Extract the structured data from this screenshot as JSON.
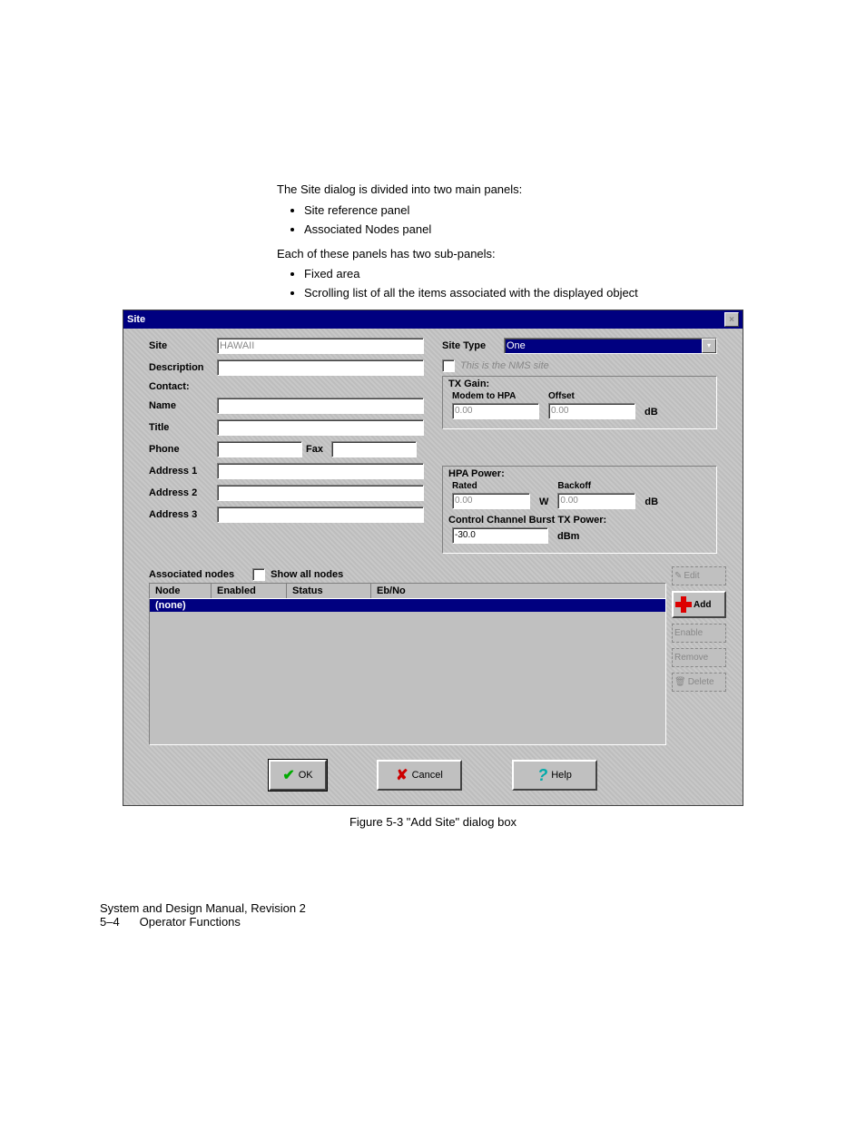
{
  "intro": {
    "line1": "The Site dialog is divided into two main panels:",
    "bullet1a": "Site reference panel",
    "bullet1b": "Associated Nodes panel",
    "line2": "Each of these panels has two sub-panels:",
    "bullet2a": "Fixed area",
    "bullet2b": "Scrolling list of all the items associated with the displayed object"
  },
  "dialog": {
    "title": "Site",
    "left": {
      "site_label": "Site",
      "site_value": "HAWAII",
      "desc_label": "Description",
      "contact_label": "Contact:",
      "name_label": "Name",
      "title_label": "Title",
      "phone_label": "Phone",
      "fax_label": "Fax",
      "addr1_label": "Address 1",
      "addr2_label": "Address 2",
      "addr3_label": "Address 3"
    },
    "right": {
      "sitetype_label": "Site Type",
      "sitetype_value": "One",
      "nms_label": "This is the NMS site",
      "txgain_label": "TX Gain:",
      "modem_label": "Modem to HPA",
      "modem_value": "0.00",
      "offset_label": "Offset",
      "offset_value": "0.00",
      "txgain_unit": "dB",
      "hpa_label": "HPA Power:",
      "rated_label": "Rated",
      "rated_value": "0.00",
      "rated_unit": "W",
      "backoff_label": "Backoff",
      "backoff_value": "0.00",
      "backoff_unit": "dB",
      "ccb_label": "Control Channel Burst TX Power:",
      "ccb_value": "-30.0",
      "ccb_unit": "dBm"
    },
    "assoc": {
      "label": "Associated nodes",
      "showall": "Show all nodes",
      "col_node": "Node",
      "col_enabled": "Enabled",
      "col_status": "Status",
      "col_ebno": "Eb/No",
      "row_none": "(none)"
    },
    "sidebtn": {
      "edit": "Edit",
      "add": "Add",
      "enable": "Enable",
      "remove": "Remove",
      "delete": "Delete"
    },
    "btn": {
      "ok": "OK",
      "cancel": "Cancel",
      "help": "Help"
    }
  },
  "caption": "Figure 5-3 \"Add Site\" dialog box",
  "footer": {
    "line1": "System and Design Manual, Revision 2",
    "pagenum": "5–4",
    "section": "Operator Functions"
  }
}
